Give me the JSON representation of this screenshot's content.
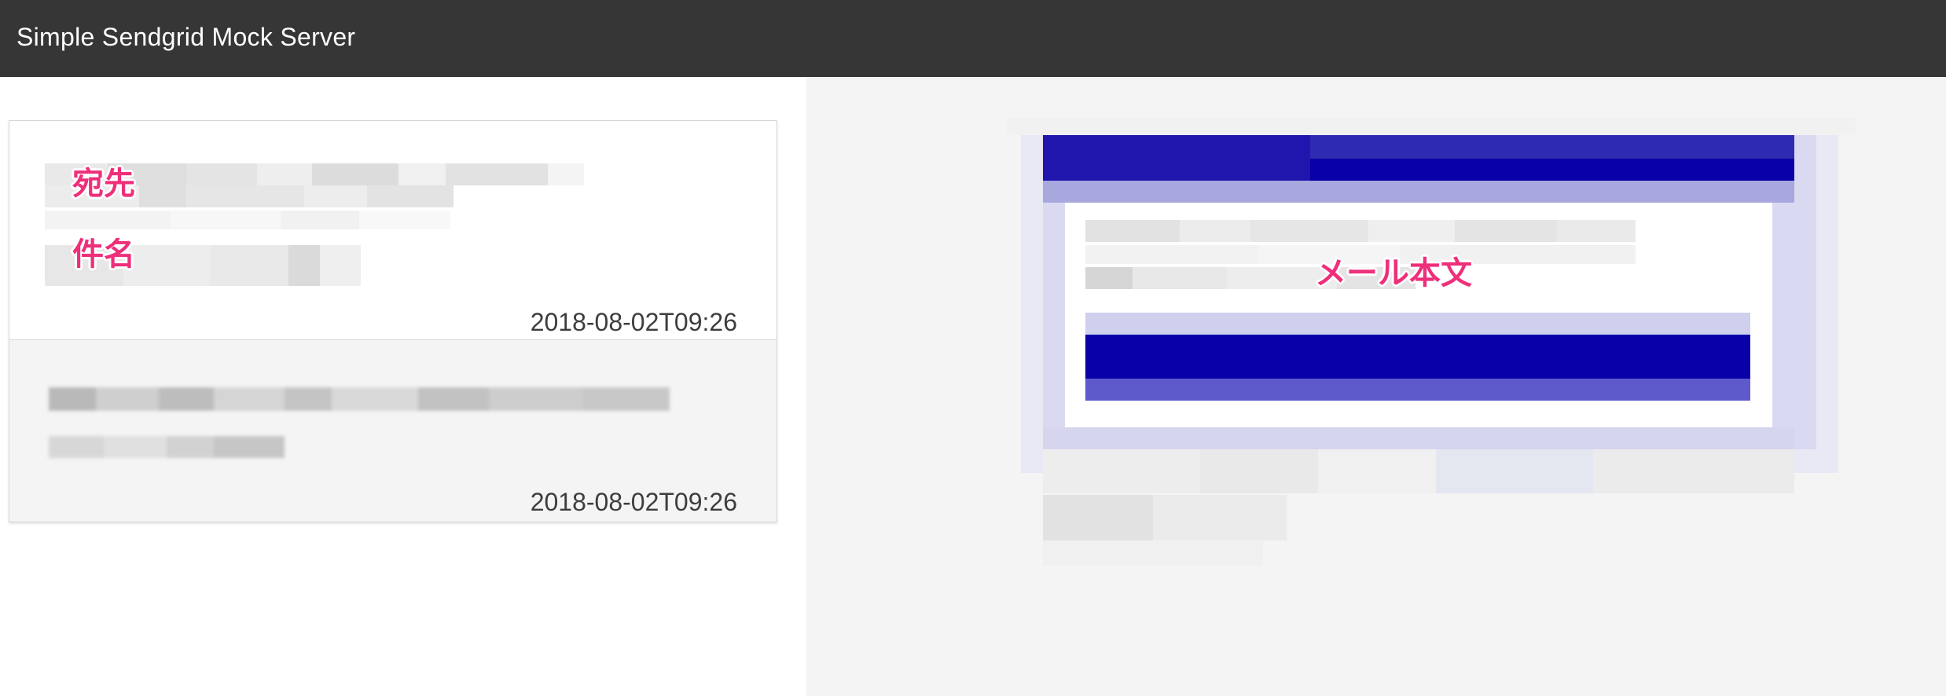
{
  "app": {
    "title": "Simple Sendgrid Mock Server"
  },
  "mail_list": [
    {
      "timestamp": "2018-08-02T09:26",
      "selected": true
    },
    {
      "timestamp": "2018-08-02T09:26",
      "selected": false
    }
  ],
  "annotations": {
    "to": "宛先",
    "subject": "件名",
    "body": "メール本文"
  },
  "colors": {
    "header": "#363636",
    "accent_annotation": "#ee2f7a",
    "email_banner": "#0a00a8"
  }
}
